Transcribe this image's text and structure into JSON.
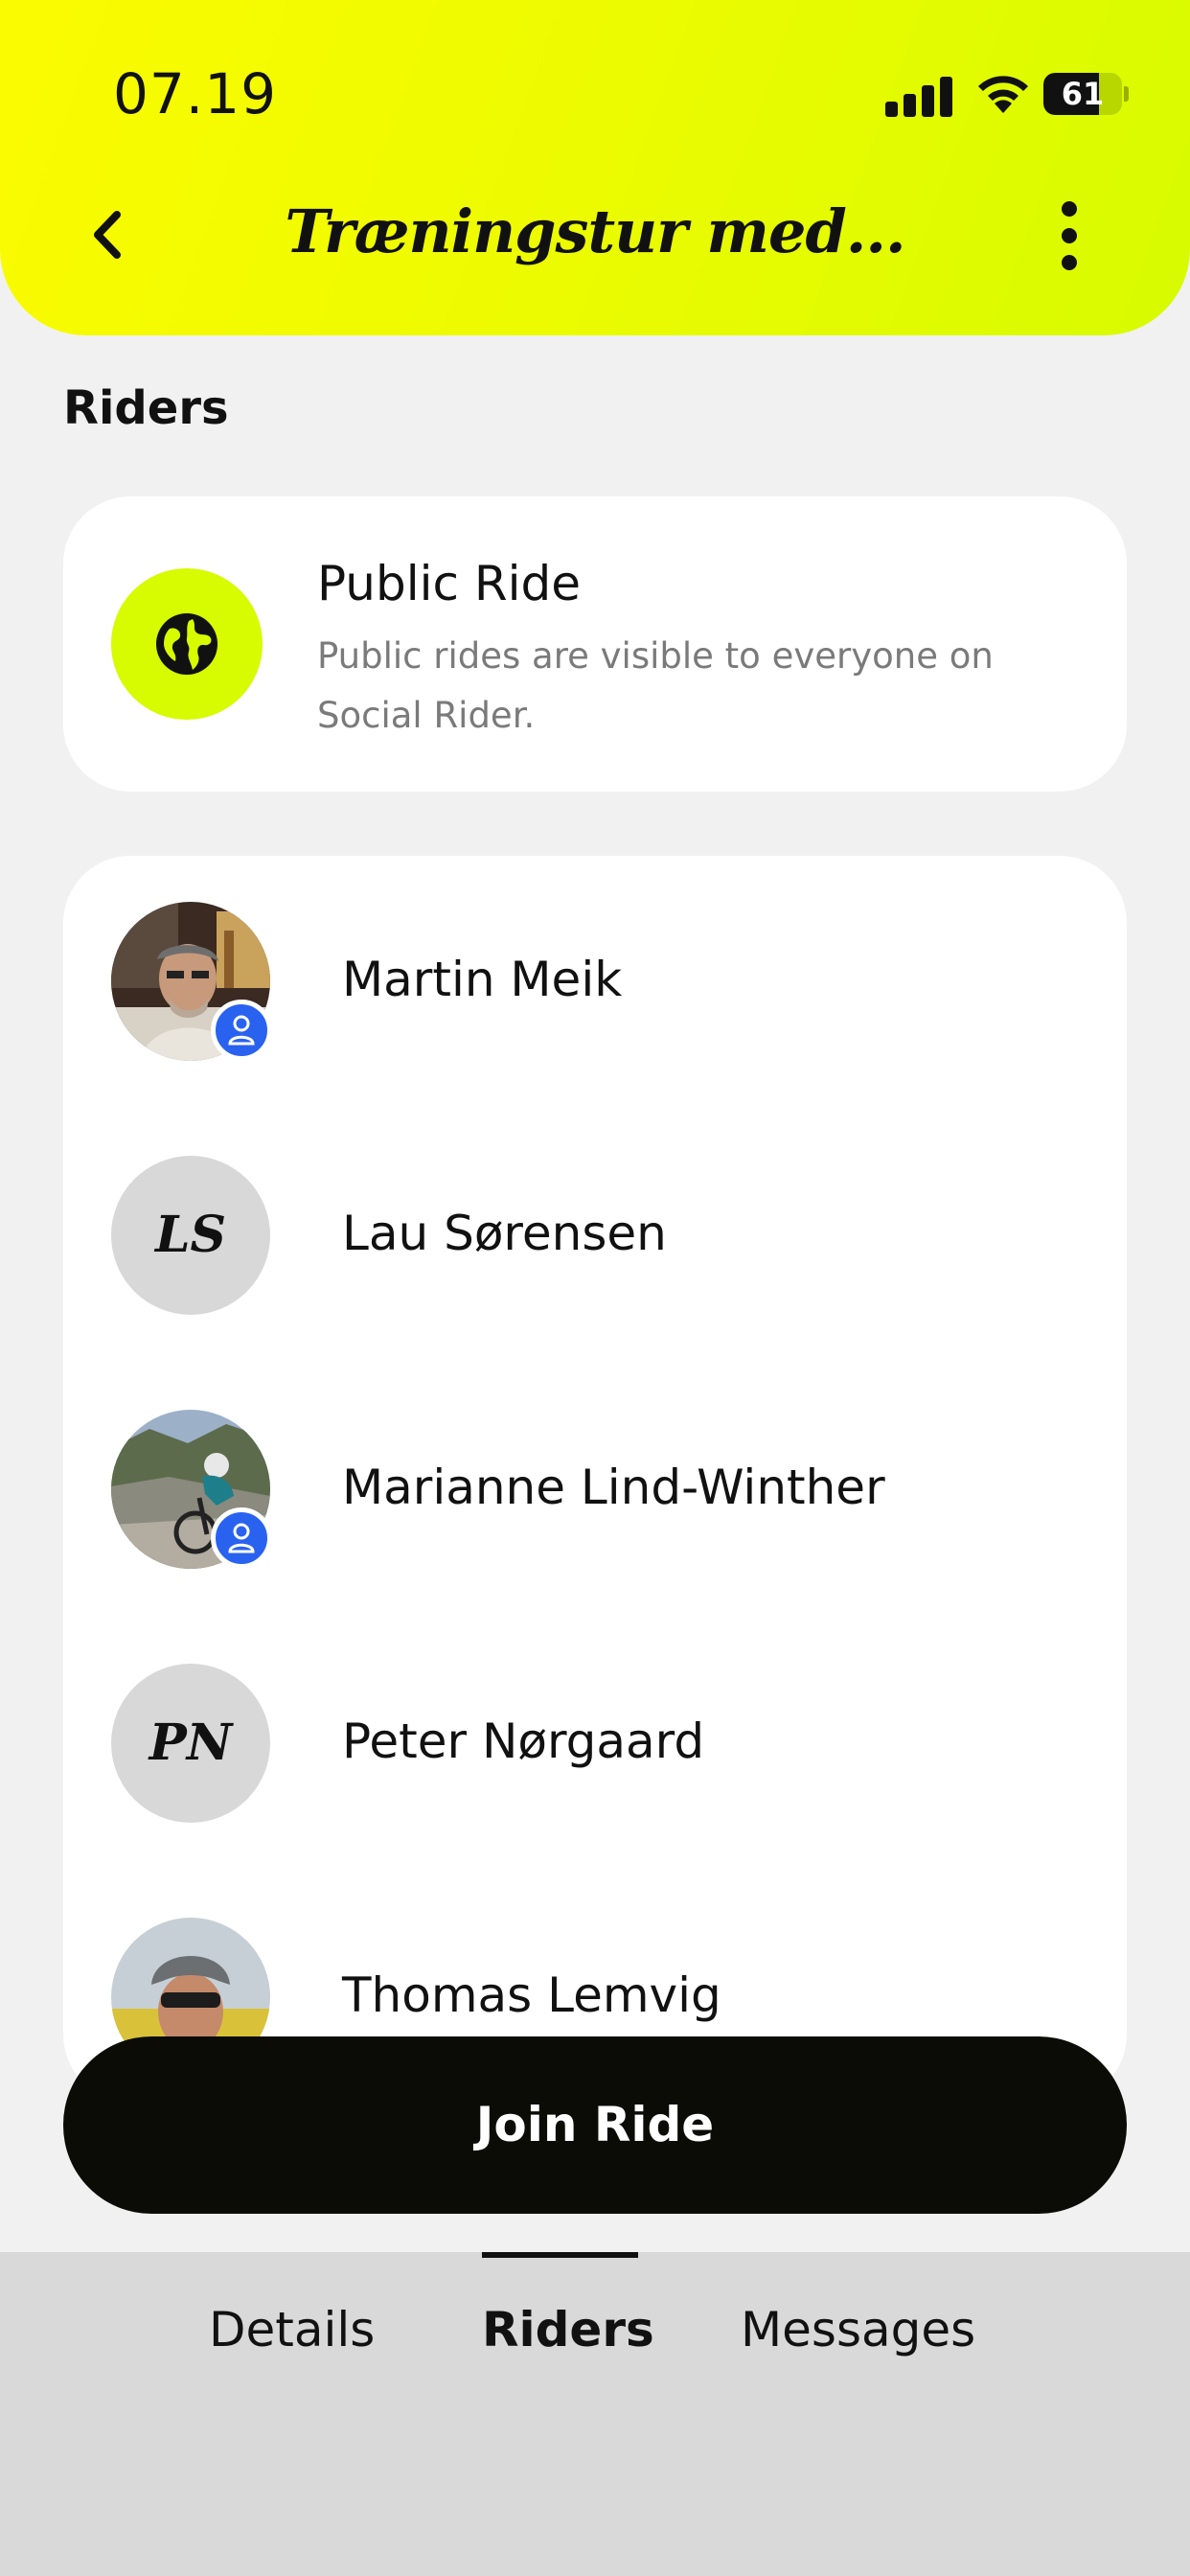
{
  "status_bar": {
    "time": "07.19",
    "battery": "61",
    "battery_level": 0.61
  },
  "header": {
    "title": "Træningstur med...",
    "back_icon": "chevron-left-icon",
    "more_icon": "vertical-ellipsis-icon"
  },
  "section": {
    "title": "Riders"
  },
  "public_ride": {
    "title": "Public Ride",
    "description": "Public rides are visible to everyone on Social Rider.",
    "icon": "globe-icon",
    "accent": "#d7fb00"
  },
  "riders": [
    {
      "name": "Martin Meik",
      "avatar": "photo",
      "badge": "person-icon"
    },
    {
      "name": "Lau Sørensen",
      "avatar": "initials",
      "initials": "LS"
    },
    {
      "name": "Marianne Lind-Winther",
      "avatar": "photo",
      "badge": "person-icon"
    },
    {
      "name": "Peter Nørgaard",
      "avatar": "initials",
      "initials": "PN"
    },
    {
      "name": "Thomas Lemvig",
      "avatar": "photo"
    }
  ],
  "join_button": {
    "label": "Join Ride"
  },
  "tabs": [
    {
      "label": "Details",
      "active": false
    },
    {
      "label": "Riders",
      "active": true
    },
    {
      "label": "Messages",
      "active": false
    }
  ],
  "colors": {
    "header_gradient_start": "#fbfb00",
    "header_gradient_end": "#d7fb00",
    "badge_blue": "#2a62f0",
    "button_black": "#0b0c06"
  }
}
